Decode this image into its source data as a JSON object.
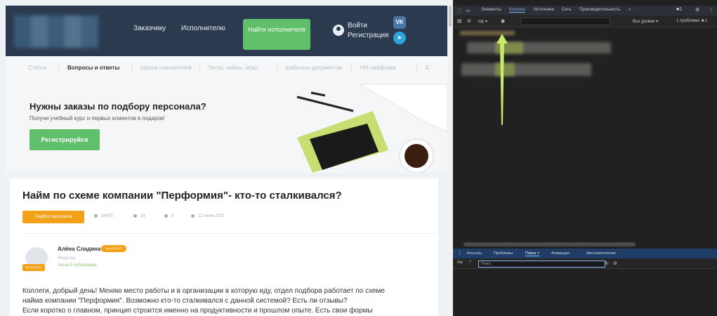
{
  "header": {
    "nav_customer": "Заказчику",
    "nav_contractor": "Исполнителю",
    "find_button": "Найти исполнителя",
    "login": "Войти",
    "register": "Регистрация",
    "vk_icon": "vk-logo-icon",
    "telegram_icon": "telegram-logo-icon"
  },
  "tabs": [
    {
      "label": "Статьи"
    },
    {
      "label": "Вопросы и ответы"
    },
    {
      "label": "Школа соискателей"
    },
    {
      "label": "Тесты, кейсы, игры"
    },
    {
      "label": "Шаблоны документов"
    },
    {
      "label": "HR-лайфхаки"
    },
    {
      "label": "Б"
    }
  ],
  "promo": {
    "title": "Нужны заказы по подбору персонала?",
    "subtitle": "Получи учебный курс и первых клиентов в подарок!",
    "button": "Регистрируйся"
  },
  "article": {
    "title": "Найм по схеме компании \"Перформия\"- кто-то сталкивался?",
    "category": "Подбор персонала",
    "views": "34075",
    "comments": "33",
    "likes": "4",
    "date": "12 июня 2023",
    "author_name": "Алёна Сладина",
    "author_badge": "НR-БЛОГЕР",
    "avatar_badge": "НR-БЛОГЕР",
    "author_role": "Рекрутер",
    "author_pubs": "Автор 5 публикаций",
    "body": [
      "Коллеги, добрый день! Меняю место работы и в организации в которую иду, отдел подбора работает по схеме",
      "найма компании \"Перформия\". Возможно кто-то сталкивался с данной системой? Есть ли отзывы?",
      "Если коротко о главном, принцип строится именно на продуктивности и прошлом опыте. Есть свои формы"
    ]
  },
  "devtools": {
    "tabs": [
      "Элементы",
      "Консоль",
      "Источники",
      "Сеть",
      "Производительность",
      "»"
    ],
    "selected_tab": "Консоль",
    "top_select": "top ▾",
    "levels": "Все уровни ▾",
    "issues": "1 проблема: ■ 1",
    "drawer_tabs": [
      "Консоль",
      "Проблемы",
      "Поиск ×",
      "Анимация",
      "Автозаполнение"
    ],
    "drawer_selected": "Поиск ×",
    "search_aa": "Аа",
    "search_regex": ".*",
    "search_placeholder": "Поиск",
    "annotation_color": "#c8e86a"
  }
}
